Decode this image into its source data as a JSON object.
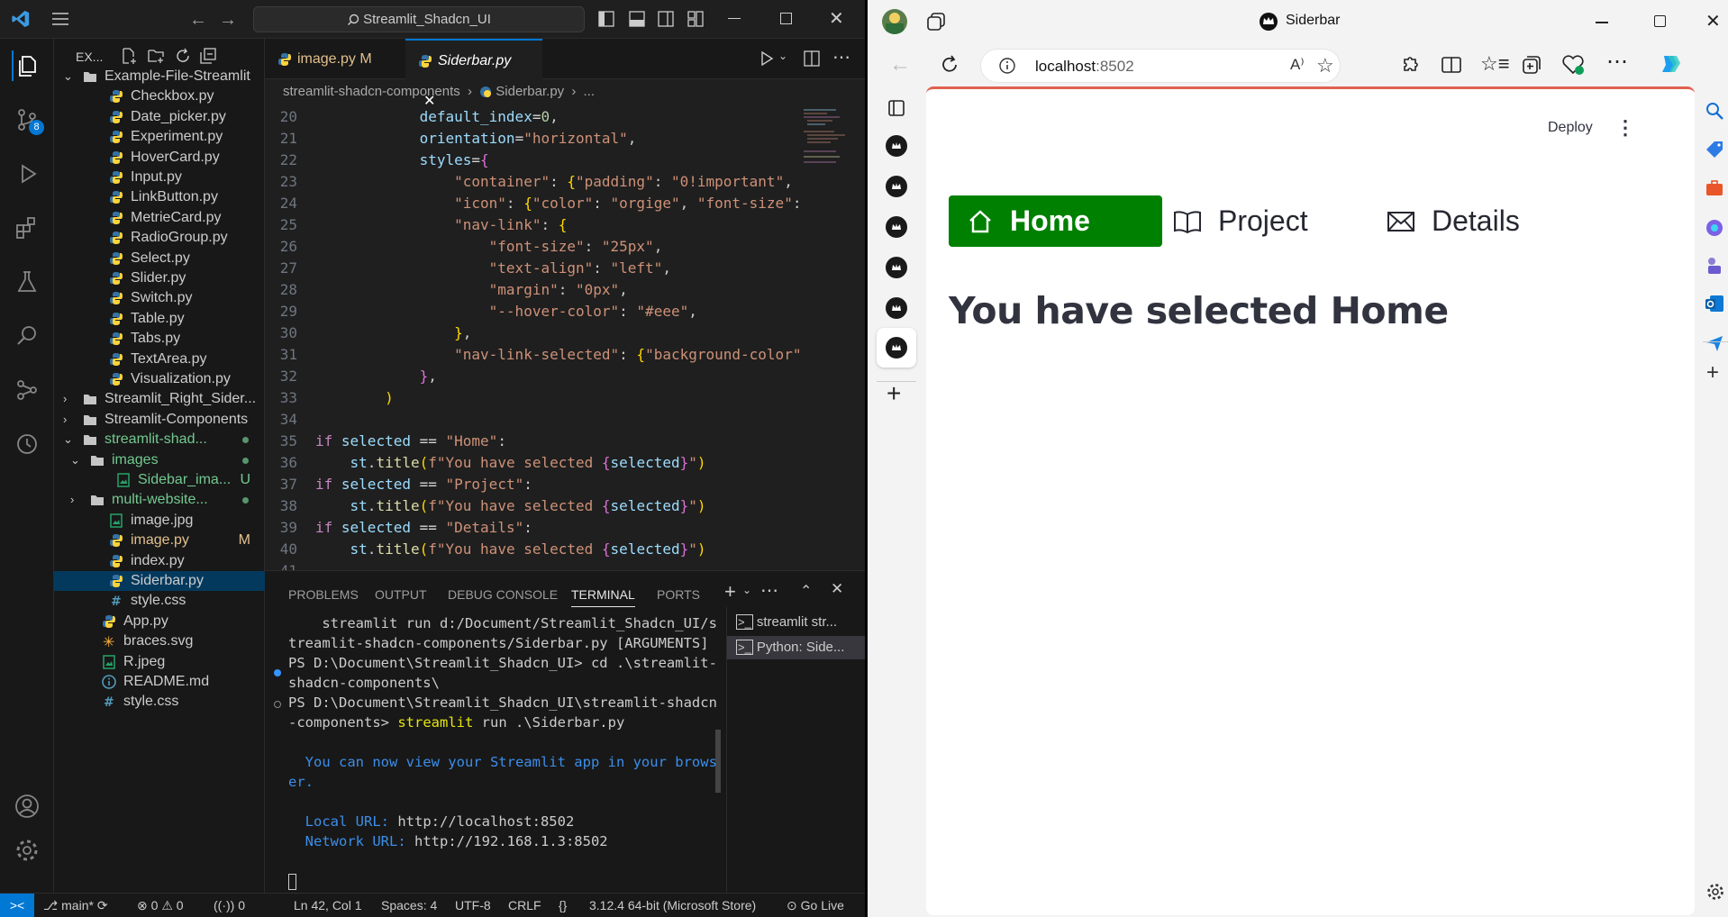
{
  "vscode": {
    "search_text": "Streamlit_Shadcn_UI",
    "activity_badge": "8",
    "explorer_title": "EX...",
    "tree": [
      {
        "label": "Example-File-Streamlit",
        "kind": "folder-open",
        "depth": 0
      },
      {
        "label": "Checkbox.py",
        "kind": "py",
        "depth": 1
      },
      {
        "label": "Date_picker.py",
        "kind": "py",
        "depth": 1
      },
      {
        "label": "Experiment.py",
        "kind": "py",
        "depth": 1
      },
      {
        "label": "HoverCard.py",
        "kind": "py",
        "depth": 1
      },
      {
        "label": "Input.py",
        "kind": "py",
        "depth": 1
      },
      {
        "label": "LinkButton.py",
        "kind": "py",
        "depth": 1
      },
      {
        "label": "MetrieCard.py",
        "kind": "py",
        "depth": 1
      },
      {
        "label": "RadioGroup.py",
        "kind": "py",
        "depth": 1
      },
      {
        "label": "Select.py",
        "kind": "py",
        "depth": 1
      },
      {
        "label": "Slider.py",
        "kind": "py",
        "depth": 1
      },
      {
        "label": "Switch.py",
        "kind": "py",
        "depth": 1
      },
      {
        "label": "Table.py",
        "kind": "py",
        "depth": 1
      },
      {
        "label": "Tabs.py",
        "kind": "py",
        "depth": 1
      },
      {
        "label": "TextArea.py",
        "kind": "py",
        "depth": 1
      },
      {
        "label": "Visualization.py",
        "kind": "py",
        "depth": 1
      },
      {
        "label": "Streamlit_Right_Sider...",
        "kind": "folder",
        "depth": 0
      },
      {
        "label": "Streamlit-Components",
        "kind": "folder",
        "depth": 0
      },
      {
        "label": "streamlit-shad...",
        "kind": "folder-open",
        "depth": 0,
        "color": "#73c991",
        "dot": true
      },
      {
        "label": "images",
        "kind": "folder-open",
        "depth": 1,
        "color": "#73c991",
        "dot": true
      },
      {
        "label": "Sidebar_ima...",
        "kind": "img",
        "depth": 2,
        "color": "#73c991",
        "status": "U"
      },
      {
        "label": "multi-website...",
        "kind": "folder",
        "depth": 1,
        "color": "#73c991",
        "dot": true
      },
      {
        "label": "image.jpg",
        "kind": "img",
        "depth": 1
      },
      {
        "label": "image.py",
        "kind": "py",
        "depth": 1,
        "color": "#e2c08d",
        "status": "M"
      },
      {
        "label": "index.py",
        "kind": "py",
        "depth": 1
      },
      {
        "label": "Siderbar.py",
        "kind": "py",
        "depth": 1,
        "selected": true
      },
      {
        "label": "style.css",
        "kind": "css",
        "depth": 1
      },
      {
        "label": "App.py",
        "kind": "py",
        "depth": 0
      },
      {
        "label": "braces.svg",
        "kind": "svg",
        "depth": 0
      },
      {
        "label": "R.jpeg",
        "kind": "img",
        "depth": 0
      },
      {
        "label": "README.md",
        "kind": "md",
        "depth": 0
      },
      {
        "label": "style.css",
        "kind": "css",
        "depth": 0
      }
    ],
    "tabs": [
      {
        "label": "image.py",
        "status": "M"
      },
      {
        "label": "Siderbar.py",
        "close": "✕"
      }
    ],
    "breadcrumb": [
      "streamlit-shadcn-components",
      "Siderbar.py",
      "..."
    ],
    "code": [
      {
        "n": "20",
        "html": "            <span class='v'>default_index</span><span class='op'>=</span><span class='n'>0</span>,"
      },
      {
        "n": "21",
        "html": "            <span class='v'>orientation</span><span class='op'>=</span><span class='s'>\"horizontal\"</span>,"
      },
      {
        "n": "22",
        "html": "            <span class='v'>styles</span><span class='op'>=</span><span class='b2'>{</span>"
      },
      {
        "n": "23",
        "html": "                <span class='s'>\"container\"</span>: <span class='p'>{</span><span class='s'>\"padding\"</span>: <span class='s'>\"0!important\"</span>,"
      },
      {
        "n": "24",
        "html": "                <span class='s'>\"icon\"</span>: <span class='p'>{</span><span class='s'>\"color\"</span>: <span class='s'>\"orgige\"</span>, <span class='s'>\"font-size\"</span>:"
      },
      {
        "n": "25",
        "html": "                <span class='s'>\"nav-link\"</span>: <span class='p'>{</span>"
      },
      {
        "n": "26",
        "html": "                    <span class='s'>\"font-size\"</span>: <span class='s'>\"25px\"</span>,"
      },
      {
        "n": "27",
        "html": "                    <span class='s'>\"text-align\"</span>: <span class='s'>\"left\"</span>,"
      },
      {
        "n": "28",
        "html": "                    <span class='s'>\"margin\"</span>: <span class='s'>\"0px\"</span>,"
      },
      {
        "n": "29",
        "html": "                    <span class='s'>\"--hover-color\"</span>: <span class='s'>\"#eee\"</span>,"
      },
      {
        "n": "30",
        "html": "                <span class='p'>}</span>,"
      },
      {
        "n": "31",
        "html": "                <span class='s'>\"nav-link-selected\"</span>: <span class='p'>{</span><span class='s'>\"background-color\"</span>"
      },
      {
        "n": "32",
        "html": "            <span class='b2'>}</span>,"
      },
      {
        "n": "33",
        "html": "        <span class='p'>)</span>"
      },
      {
        "n": "34",
        "html": ""
      },
      {
        "n": "35",
        "html": "<span class='k'>if</span> <span class='v'>selected</span> <span class='op'>==</span> <span class='s'>\"Home\"</span>:"
      },
      {
        "n": "36",
        "html": "    <span class='v'>st</span>.<span class='f'>title</span><span class='p'>(</span><span class='s'>f\"You have selected </span><span class='b2'>{</span><span class='v'>selected</span><span class='b2'>}</span><span class='s'>\"</span><span class='p'>)</span>"
      },
      {
        "n": "37",
        "html": "<span class='k'>if</span> <span class='v'>selected</span> <span class='op'>==</span> <span class='s'>\"Project\"</span>:"
      },
      {
        "n": "38",
        "html": "    <span class='v'>st</span>.<span class='f'>title</span><span class='p'>(</span><span class='s'>f\"You have selected </span><span class='b2'>{</span><span class='v'>selected</span><span class='b2'>}</span><span class='s'>\"</span><span class='p'>)</span>"
      },
      {
        "n": "39",
        "html": "<span class='k'>if</span> <span class='v'>selected</span> <span class='op'>==</span> <span class='s'>\"Details\"</span>:"
      },
      {
        "n": "40",
        "html": "    <span class='v'>st</span>.<span class='f'>title</span><span class='p'>(</span><span class='s'>f\"You have selected </span><span class='b2'>{</span><span class='v'>selected</span><span class='b2'>}</span><span class='s'>\"</span><span class='p'>)</span>"
      },
      {
        "n": "41",
        "html": ""
      }
    ],
    "panel_tabs": [
      "PROBLEMS",
      "OUTPUT",
      "DEBUG CONSOLE",
      "TERMINAL",
      "PORTS"
    ],
    "terminal_lines": [
      "    streamlit run d:/Document/Streamlit_Shadcn_UI/s",
      "treamlit-shadcn-components/Siderbar.py [ARGUMENTS]",
      "PS D:\\Document\\Streamlit_Shadcn_UI> cd .\\streamlit-",
      "shadcn-components\\",
      "PS D:\\Document\\Streamlit_Shadcn_UI\\streamlit-shadcn",
      "-components> streamlit run .\\Siderbar.py",
      "",
      "  You can now view your Streamlit app in your brows",
      "er.",
      "",
      "  Local URL: http://localhost:8502",
      "  Network URL: http://192.168.1.3:8502",
      "",
      "[]"
    ],
    "terminal_list": [
      "streamlit  str...",
      "Python: Side..."
    ],
    "status": {
      "branch": "main*",
      "errors": "0",
      "warnings": "0",
      "ports": "0",
      "position": "Ln 42, Col 1",
      "spaces": "Spaces: 4",
      "encoding": "UTF-8",
      "eol": "CRLF",
      "python": "3.12.4 64-bit (Microsoft Store)",
      "golive": "Go Live"
    }
  },
  "browser": {
    "tab_title": "Siderbar",
    "address": "localhost",
    "port": ":8502",
    "deploy_label": "Deploy",
    "nav": [
      {
        "label": "Home",
        "icon": "house-icon",
        "selected": true
      },
      {
        "label": "Project",
        "icon": "book-icon"
      },
      {
        "label": "Details",
        "icon": "envelope-icon"
      }
    ],
    "heading": "You have selected Home",
    "accent": "#008000"
  }
}
